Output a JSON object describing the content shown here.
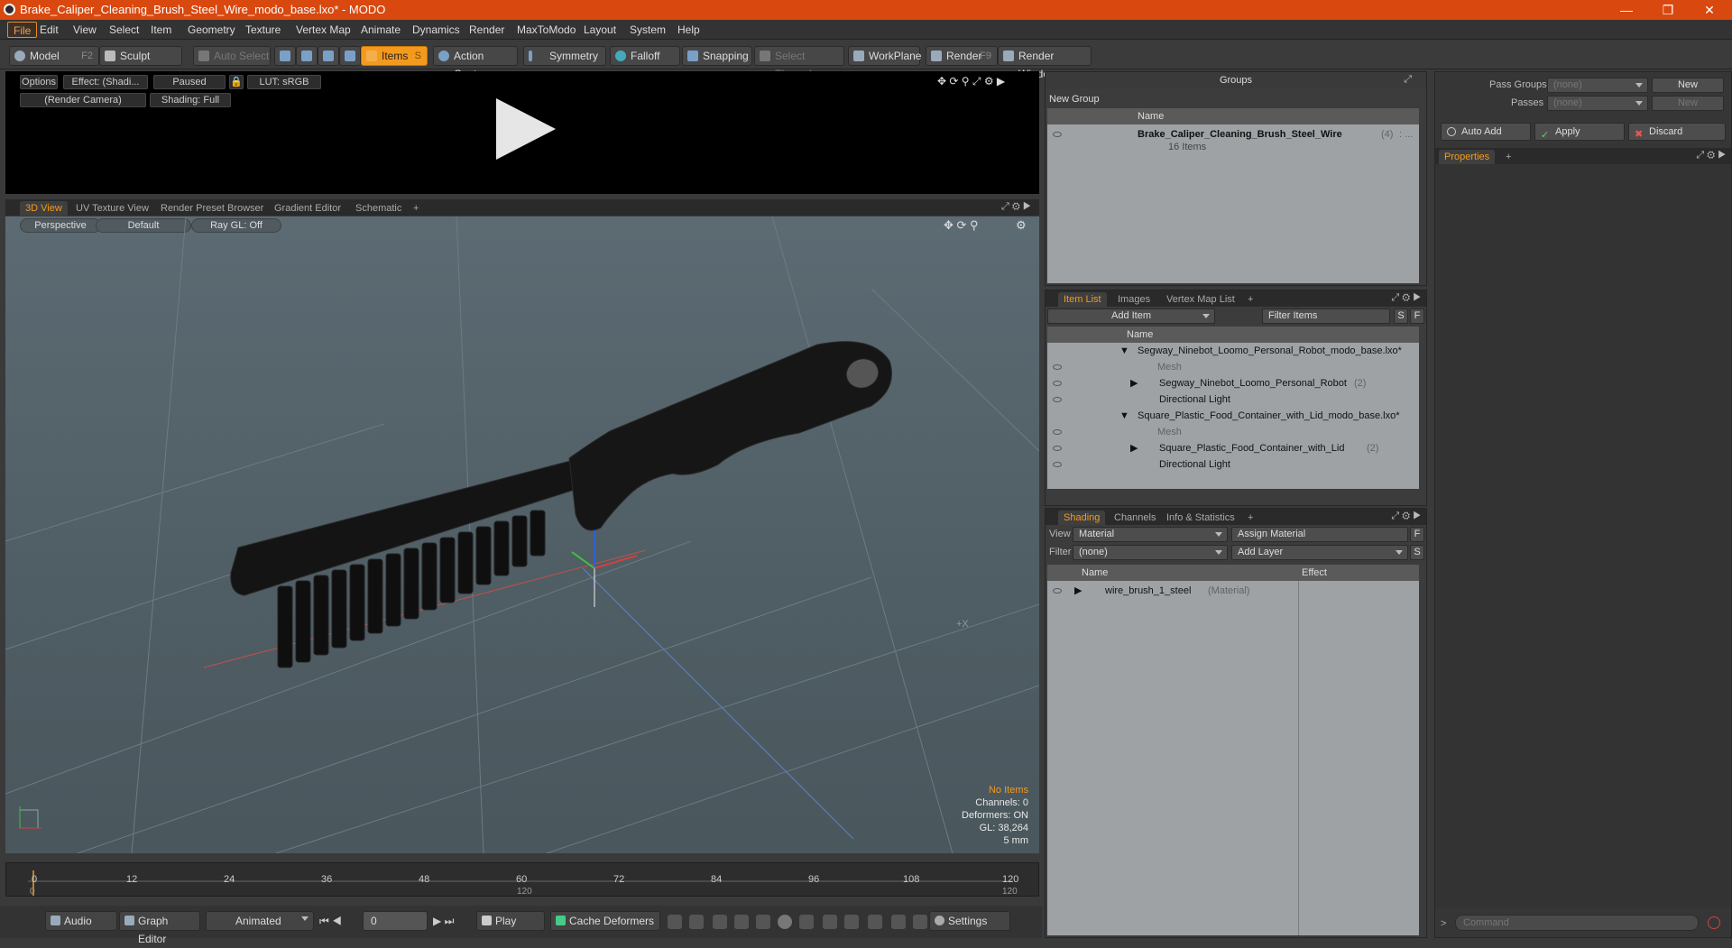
{
  "window": {
    "title": "Brake_Caliper_Cleaning_Brush_Steel_Wire_modo_base.lxo* - MODO"
  },
  "menu": [
    "File",
    "Edit",
    "View",
    "Select",
    "Item",
    "Geometry",
    "Texture",
    "Vertex Map",
    "Animate",
    "Dynamics",
    "Render",
    "MaxToModo",
    "Layout",
    "System",
    "Help"
  ],
  "toolbar": {
    "model": "Model",
    "model_key": "F2",
    "sculpt": "Sculpt",
    "auto_select": "Auto Select",
    "items": "Items",
    "items_key": "S",
    "action_center": "Action Center",
    "symmetry": "Symmetry",
    "falloff": "Falloff",
    "snapping": "Snapping",
    "select_through": "Select Through",
    "workplane": "WorkPlane",
    "render": "Render",
    "render_key": "F9",
    "render_window": "Render Window"
  },
  "preview": {
    "options": "Options",
    "effect": "Effect: (Shadi...",
    "paused": "Paused",
    "lut": "LUT: sRGB",
    "camera": "(Render Camera)",
    "shading": "Shading: Full"
  },
  "viewport_tabs": [
    "3D View",
    "UV Texture View",
    "Render Preset Browser",
    "Gradient Editor",
    "Schematic",
    "+"
  ],
  "viewport": {
    "perspective": "Perspective",
    "default": "Default",
    "raygl": "Ray GL: Off",
    "axis_label": "+X"
  },
  "hud": {
    "no_items": "No Items",
    "channels": "Channels: 0",
    "deformers": "Deformers: ON",
    "gl": "GL: 38,264",
    "scale": "5 mm"
  },
  "timeline": {
    "ticks": [
      "0",
      "12",
      "24",
      "36",
      "48",
      "60",
      "72",
      "84",
      "96",
      "108",
      "120"
    ],
    "start": "0",
    "mid": "120",
    "end": "120"
  },
  "bottom": {
    "audio": "Audio",
    "graph_editor": "Graph Editor",
    "animated": "Animated",
    "frame": "0",
    "play": "Play",
    "cache": "Cache Deformers",
    "settings": "Settings"
  },
  "groups": {
    "title": "Groups",
    "new_group": "New Group",
    "col_name": "Name",
    "item_name": "Brake_Caliper_Cleaning_Brush_Steel_Wire",
    "item_count": "(4)",
    "item_more": ": ...",
    "sub": "16 Items"
  },
  "pass": {
    "pass_groups": "Pass Groups",
    "passes": "Passes",
    "none1": "(none)",
    "none2": "(none)",
    "new1": "New",
    "new2": "New"
  },
  "actions": {
    "auto_add": "Auto Add",
    "apply": "Apply",
    "discard": "Discard"
  },
  "properties": {
    "tab": "Properties",
    "plus": "+"
  },
  "itemlist": {
    "tabs": [
      "Item List",
      "Images",
      "Vertex Map List",
      "+"
    ],
    "add_item": "Add Item",
    "filter": "Filter Items",
    "s": "S",
    "f": "F",
    "col_name": "Name",
    "rows": [
      {
        "name": "Segway_Ninebot_Loomo_Personal_Robot_modo_base.lxo*",
        "extra": ""
      },
      {
        "name": "Mesh",
        "extra": ""
      },
      {
        "name": "Segway_Ninebot_Loomo_Personal_Robot",
        "extra": "(2)"
      },
      {
        "name": "Directional Light",
        "extra": ""
      },
      {
        "name": "Square_Plastic_Food_Container_with_Lid_modo_base.lxo*",
        "extra": ""
      },
      {
        "name": "Mesh",
        "extra": ""
      },
      {
        "name": "Square_Plastic_Food_Container_with_Lid",
        "extra": "(2)"
      },
      {
        "name": "Directional Light",
        "extra": ""
      }
    ]
  },
  "shading": {
    "tabs": [
      "Shading",
      "Channels",
      "Info & Statistics",
      "+"
    ],
    "view_label": "View",
    "view_value": "Material",
    "assign": "Assign Material",
    "f": "F",
    "filter_label": "Filter",
    "filter_value": "(none)",
    "add_layer": "Add Layer",
    "s": "S",
    "col_name": "Name",
    "col_effect": "Effect",
    "row_name": "wire_brush_1_steel",
    "row_type": "(Material)"
  },
  "command": {
    "placeholder": "Command"
  }
}
